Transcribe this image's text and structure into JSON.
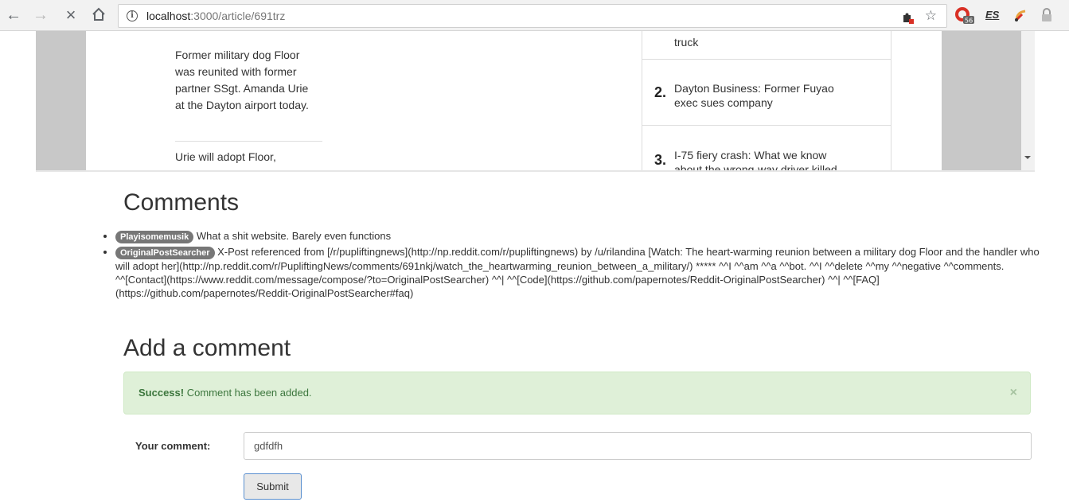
{
  "browser": {
    "url_host": "localhost",
    "url_path": ":3000/article/691trz",
    "info_symbol": "i",
    "ext_es_label": "ES"
  },
  "embed": {
    "article_paragraph_1": "Former military dog Floor was reunited with former partner SSgt. Amanda Urie at the Dayton airport today.",
    "article_paragraph_2": "Urie will adopt Floor,",
    "trending": [
      {
        "num": "",
        "text": "truck"
      },
      {
        "num": "2.",
        "text": "Dayton Business: Former Fuyao exec sues company"
      },
      {
        "num": "3.",
        "text": "I-75 fiery crash: What we know about the wrong-way driver killed"
      }
    ]
  },
  "comments": {
    "heading": "Comments",
    "items": [
      {
        "author": "Playisomemusik",
        "text": "What a shit website. Barely even functions"
      },
      {
        "author": "OriginalPostSearcher",
        "text": "X-Post referenced from [/r/pupliftingnews](http://np.reddit.com/r/pupliftingnews) by /u/rilandina [Watch: The heart-warming reunion between a military dog Floor and the handler who will adopt her](http://np.reddit.com/r/PupliftingNews/comments/691nkj/watch_the_heartwarming_reunion_between_a_military/) ***** ^^I ^^am ^^a ^^bot. ^^I ^^delete ^^my ^^negative ^^comments. ^^[Contact](https://www.reddit.com/message/compose/?to=OriginalPostSearcher) ^^| ^^[Code](https://github.com/papernotes/Reddit-OriginalPostSearcher) ^^| ^^[FAQ](https://github.com/papernotes/Reddit-OriginalPostSearcher#faq)"
      }
    ]
  },
  "add_comment": {
    "heading": "Add a comment",
    "alert_strong": "Success!",
    "alert_text": " Comment has been added.",
    "alert_close": "×",
    "label": "Your comment:",
    "input_value": "gdfdfh",
    "submit_label": "Submit"
  }
}
